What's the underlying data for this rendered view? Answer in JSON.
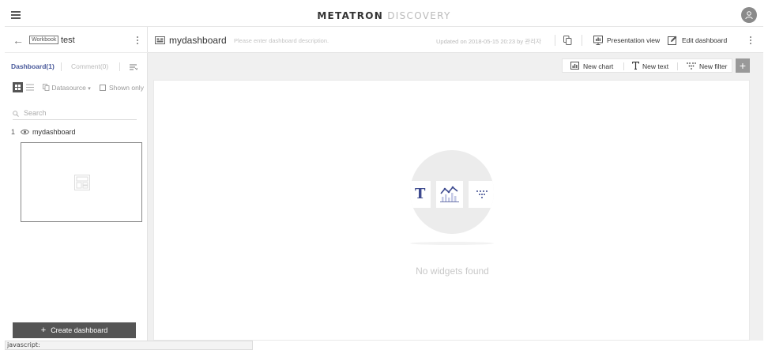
{
  "header": {
    "logo_primary": "METATRON",
    "logo_secondary": "DISCOVERY"
  },
  "workbook": {
    "badge": "Workbook",
    "name": "test"
  },
  "sidebar": {
    "tab_dashboard": "Dashboard(1)",
    "tab_comment": "Comment(0)",
    "datasource_label": "Datasource",
    "shown_only_label": "Shown only",
    "search_placeholder": "Search",
    "items": [
      {
        "number": "1",
        "name": "mydashboard"
      }
    ],
    "create_button": "Create dashboard"
  },
  "dashboard": {
    "title": "mydashboard",
    "description_placeholder": "Please enter dashboard description.",
    "updated_text": "Updated on 2018-05-15 20:23 by 관리자",
    "presentation_view": "Presentation view",
    "edit_dashboard": "Edit dashboard"
  },
  "toolbar": {
    "new_chart": "New chart",
    "new_text": "New text",
    "new_filter": "New filter",
    "add_symbol": "+"
  },
  "canvas": {
    "empty_message": "No widgets found",
    "tile_text_glyph": "T"
  },
  "status_bar": {
    "text": "javascript:"
  },
  "colors": {
    "accent": "#4a5a9b",
    "button_dark": "#555555",
    "empty_icon": "#3d4a8f"
  }
}
